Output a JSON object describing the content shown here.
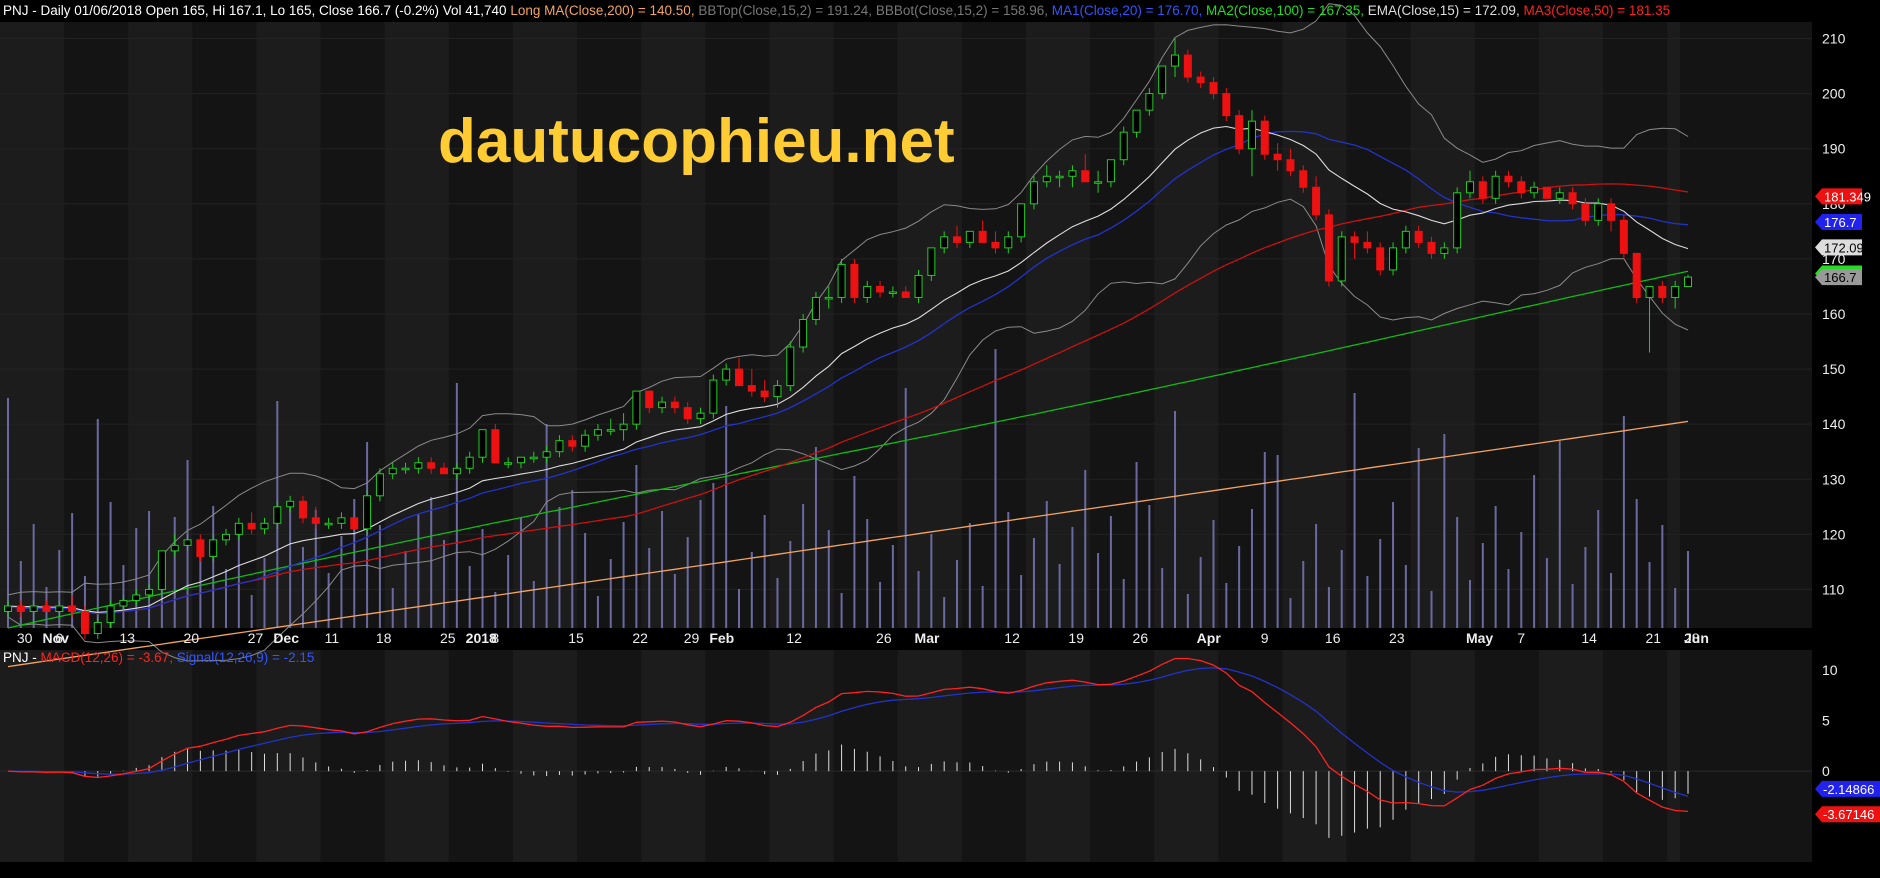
{
  "header": {
    "main_prefix": "PNJ - Daily 01/06/2018 Open 165, Hi 167.1, Lo 165, Close 166.7 (-0.2%) Vol 41,740",
    "items": [
      {
        "text": " Long MA(Close,200) = 140.50,",
        "color": "#f4a460"
      },
      {
        "text": " BBTop(Close,15,2) = 191.24,",
        "color": "#777777"
      },
      {
        "text": " BBBot(Close,15,2) = 158.96,",
        "color": "#777777"
      },
      {
        "text": " MA1(Close,20) = 176.70,",
        "color": "#3355ff"
      },
      {
        "text": " MA2(Close,100) = 167.35,",
        "color": "#22dd22"
      },
      {
        "text": " EMA(Close,15) = 172.09,",
        "color": "#dddddd"
      },
      {
        "text": " MA3(Close,50) = 181.35",
        "color": "#ff2222"
      }
    ],
    "macd_prefix": "PNJ - ",
    "macd_items": [
      {
        "text": "MACD(12,26) = -3.67,",
        "color": "#ff2222"
      },
      {
        "text": " Signal(12,26,9) = -2.15",
        "color": "#3355ff"
      }
    ]
  },
  "watermark": "dautucophieu.net",
  "colors": {
    "up": "#22cc22",
    "down": "#ee1111",
    "ma200": "#f4a460",
    "bb": "#8a8a8a",
    "ma20": "#2233cc",
    "ma100": "#11bb11",
    "ema15": "#dddddd",
    "ma50": "#cc1111",
    "volume": "#6a6aa0",
    "macd": "#ff2222",
    "signal": "#2233cc",
    "histogram": "#dddddd",
    "watermark": "#ffcc33"
  },
  "price_axis": {
    "ticks": [
      110,
      120,
      130,
      140,
      150,
      160,
      170,
      180,
      190,
      200,
      210
    ],
    "range": [
      103,
      213
    ]
  },
  "value_badges": [
    {
      "value": "181.349",
      "bg": "#ee1111",
      "fg": "#ffffff"
    },
    {
      "value": "176.7",
      "bg": "#2222ee",
      "fg": "#ffffff"
    },
    {
      "value": "172.09",
      "bg": "#dddddd",
      "fg": "#000000"
    },
    {
      "value": "167.348",
      "bg": "#22dd22",
      "fg": "#000000"
    },
    {
      "value": "166.7",
      "bg": "#999999",
      "fg": "#000000"
    }
  ],
  "macd_axis": {
    "ticks": [
      0,
      5,
      10
    ],
    "range": [
      -9,
      12
    ]
  },
  "macd_badges": [
    {
      "value": "-2.14866",
      "bg": "#2222ee",
      "fg": "#ffffff"
    },
    {
      "value": "-3.67146",
      "bg": "#ee1111",
      "fg": "#ffffff"
    }
  ],
  "x_labels": [
    "30",
    "Nov",
    "6",
    "13",
    "20",
    "27",
    "Dec",
    "11",
    "18",
    "25",
    "2018",
    "8",
    "15",
    "22",
    "29",
    "Feb",
    "12",
    "26",
    "Mar",
    "12",
    "19",
    "26",
    "Apr",
    "9",
    "16",
    "23",
    "May",
    "7",
    "14",
    "21",
    "28",
    "Jun"
  ],
  "chart_data": {
    "type": "candlestick",
    "title": "PNJ - Daily 01/06/2018",
    "last_bar": {
      "open": 165,
      "high": 167.1,
      "low": 165,
      "close": 166.7,
      "change": "-0.2%",
      "volume": "41,740"
    },
    "indicators": {
      "ma200": 140.5,
      "bb_top": 191.24,
      "bb_bot": 158.96,
      "ma20": 176.7,
      "ma100": 167.35,
      "ema15": 172.09,
      "ma50": 181.35
    },
    "candles": [
      [
        106,
        108,
        105,
        107
      ],
      [
        107,
        108,
        105,
        106
      ],
      [
        106,
        108,
        104,
        107
      ],
      [
        107,
        108,
        106,
        106
      ],
      [
        106,
        108,
        105,
        107
      ],
      [
        107,
        109,
        105,
        106
      ],
      [
        106,
        107,
        101,
        102
      ],
      [
        102,
        105,
        101,
        104
      ],
      [
        104,
        108,
        103,
        107
      ],
      [
        107,
        109,
        106,
        108
      ],
      [
        108,
        110,
        107,
        109
      ],
      [
        109,
        111,
        108,
        110
      ],
      [
        110,
        117,
        109,
        117
      ],
      [
        117,
        120,
        116,
        118
      ],
      [
        118,
        120,
        117,
        119
      ],
      [
        119,
        120,
        115,
        116
      ],
      [
        116,
        120,
        115,
        119
      ],
      [
        119,
        121,
        118,
        120
      ],
      [
        120,
        123,
        119,
        122
      ],
      [
        122,
        124,
        120,
        121
      ],
      [
        121,
        123,
        120,
        122
      ],
      [
        122,
        126,
        121,
        125
      ],
      [
        125,
        127,
        124,
        126
      ],
      [
        126,
        127,
        122,
        123
      ],
      [
        123,
        125,
        121,
        122
      ],
      [
        122,
        123,
        121,
        122
      ],
      [
        122,
        124,
        121,
        123
      ],
      [
        123,
        123,
        121,
        121
      ],
      [
        121,
        128,
        120,
        127
      ],
      [
        127,
        132,
        126,
        131
      ],
      [
        131,
        133,
        130,
        132
      ],
      [
        132,
        133,
        131,
        132
      ],
      [
        132,
        134,
        131,
        133
      ],
      [
        133,
        134,
        131,
        132
      ],
      [
        132,
        133,
        131,
        131
      ],
      [
        131,
        133,
        130,
        132
      ],
      [
        132,
        135,
        131,
        134
      ],
      [
        134,
        139,
        133,
        139
      ],
      [
        139,
        140,
        133,
        133
      ],
      [
        133,
        134,
        132,
        133
      ],
      [
        133,
        134,
        132,
        134
      ],
      [
        134,
        135,
        133,
        134
      ],
      [
        134,
        136,
        133,
        135
      ],
      [
        135,
        138,
        134,
        137
      ],
      [
        137,
        138,
        135,
        136
      ],
      [
        136,
        139,
        135,
        138
      ],
      [
        138,
        140,
        137,
        139
      ],
      [
        139,
        141,
        138,
        139
      ],
      [
        139,
        142,
        137,
        140
      ],
      [
        140,
        146,
        139,
        146
      ],
      [
        146,
        146,
        142,
        143
      ],
      [
        143,
        145,
        142,
        144
      ],
      [
        144,
        145,
        142,
        143
      ],
      [
        143,
        144,
        140,
        141
      ],
      [
        141,
        143,
        140,
        142
      ],
      [
        142,
        149,
        141,
        148
      ],
      [
        148,
        151,
        147,
        150
      ],
      [
        150,
        152,
        147,
        147
      ],
      [
        147,
        150,
        145,
        146
      ],
      [
        146,
        148,
        144,
        145
      ],
      [
        145,
        148,
        143,
        147
      ],
      [
        147,
        155,
        146,
        154
      ],
      [
        154,
        160,
        153,
        159
      ],
      [
        159,
        164,
        158,
        163
      ],
      [
        163,
        165,
        161,
        163
      ],
      [
        163,
        170,
        162,
        169
      ],
      [
        169,
        170,
        162,
        163
      ],
      [
        163,
        166,
        162,
        165
      ],
      [
        165,
        166,
        163,
        164
      ],
      [
        164,
        165,
        163,
        164
      ],
      [
        164,
        165,
        163,
        163
      ],
      [
        163,
        168,
        162,
        167
      ],
      [
        167,
        172,
        166,
        172
      ],
      [
        172,
        175,
        171,
        174
      ],
      [
        174,
        176,
        172,
        173
      ],
      [
        173,
        175,
        172,
        175
      ],
      [
        175,
        177,
        173,
        173
      ],
      [
        173,
        175,
        171,
        172
      ],
      [
        172,
        175,
        171,
        174
      ],
      [
        174,
        180,
        173,
        180
      ],
      [
        180,
        185,
        179,
        184
      ],
      [
        184,
        187,
        183,
        185
      ],
      [
        185,
        186,
        183,
        185
      ],
      [
        185,
        187,
        183,
        186
      ],
      [
        186,
        189,
        184,
        184
      ],
      [
        184,
        186,
        182,
        184
      ],
      [
        184,
        188,
        183,
        188
      ],
      [
        188,
        194,
        187,
        193
      ],
      [
        193,
        197,
        192,
        197
      ],
      [
        197,
        201,
        196,
        200
      ],
      [
        200,
        205,
        199,
        205
      ],
      [
        205,
        210,
        203,
        207
      ],
      [
        207,
        208,
        202,
        203
      ],
      [
        203,
        204,
        201,
        202
      ],
      [
        202,
        203,
        199,
        200
      ],
      [
        200,
        201,
        195,
        196
      ],
      [
        196,
        197,
        189,
        190
      ],
      [
        190,
        197,
        185,
        195
      ],
      [
        195,
        196,
        188,
        189
      ],
      [
        189,
        191,
        186,
        188
      ],
      [
        188,
        190,
        185,
        186
      ],
      [
        186,
        187,
        182,
        183
      ],
      [
        183,
        185,
        177,
        178
      ],
      [
        178,
        179,
        165,
        166
      ],
      [
        166,
        175,
        165,
        174
      ],
      [
        174,
        175,
        170,
        173
      ],
      [
        173,
        175,
        171,
        172
      ],
      [
        172,
        173,
        167,
        168
      ],
      [
        168,
        173,
        167,
        172
      ],
      [
        172,
        176,
        171,
        175
      ],
      [
        175,
        176,
        172,
        173
      ],
      [
        173,
        174,
        170,
        171
      ],
      [
        171,
        173,
        170,
        172
      ],
      [
        172,
        183,
        171,
        182
      ],
      [
        182,
        186,
        181,
        184
      ],
      [
        184,
        185,
        180,
        181
      ],
      [
        181,
        186,
        180,
        185
      ],
      [
        185,
        186,
        183,
        184
      ],
      [
        184,
        185,
        181,
        182
      ],
      [
        182,
        184,
        181,
        183
      ],
      [
        183,
        183,
        181,
        181
      ],
      [
        181,
        183,
        180,
        182
      ],
      [
        182,
        183,
        179,
        180
      ],
      [
        180,
        181,
        176,
        177
      ],
      [
        177,
        181,
        176,
        180
      ],
      [
        180,
        181,
        175,
        177
      ],
      [
        177,
        178,
        170,
        171
      ],
      [
        171,
        171,
        162,
        163
      ],
      [
        163,
        165,
        153,
        165
      ],
      [
        165,
        166,
        162,
        163
      ],
      [
        163,
        166,
        161,
        165
      ],
      [
        165,
        167.1,
        165,
        166.7
      ]
    ]
  }
}
